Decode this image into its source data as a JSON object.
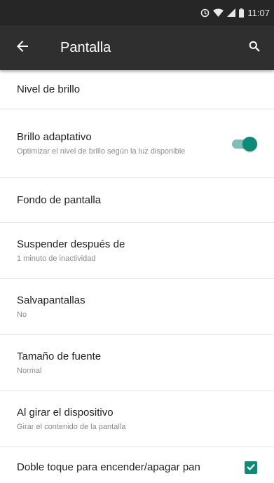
{
  "status_bar": {
    "time": "11:07",
    "icons": [
      "alarm-icon",
      "wifi-icon",
      "signal-icon",
      "battery-icon"
    ]
  },
  "toolbar": {
    "title": "Pantalla",
    "back_icon": "arrow-back-icon",
    "search_icon": "search-icon"
  },
  "settings": {
    "brightness": {
      "title": "Nivel de brillo"
    },
    "adaptive": {
      "title": "Brillo adaptativo",
      "summary": "Optimizar el nivel de brillo según la luz disponible",
      "toggle_on": true
    },
    "wallpaper": {
      "title": "Fondo de pantalla"
    },
    "sleep": {
      "title": "Suspender después de",
      "summary": "1 minuto de inactividad"
    },
    "daydream": {
      "title": "Salvapantallas",
      "summary": "No"
    },
    "font_size": {
      "title": "Tamaño de fuente",
      "summary": "Normal"
    },
    "rotation": {
      "title": "Al girar el dispositivo",
      "summary": "Girar el contenido de la pantalla"
    },
    "double_tap": {
      "title": "Doble toque para encender/apagar pan",
      "checked": true
    }
  },
  "colors": {
    "accent": "#0d8b79",
    "toolbar": "#2f2f2f",
    "status_bar": "#262626"
  }
}
